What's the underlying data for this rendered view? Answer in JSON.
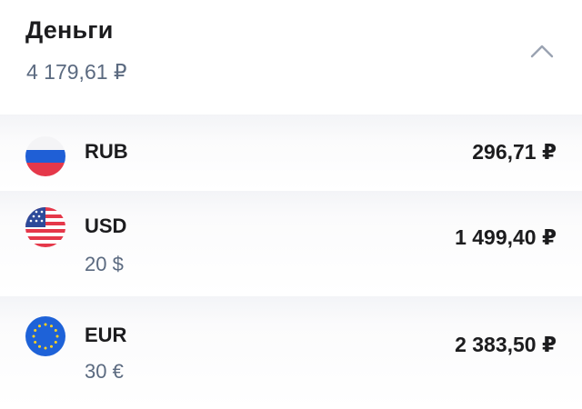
{
  "header": {
    "title": "Деньги",
    "total": "4 179,61 ₽",
    "collapse_icon": "chevron-up-icon"
  },
  "colors": {
    "text_primary": "#1c1c1e",
    "text_secondary": "#5b6a80",
    "chevron": "#9aa3b2",
    "eur_blue": "#1e62d8"
  },
  "currencies": [
    {
      "code": "RUB",
      "amount": "296,71 ₽",
      "flag": "russia-flag-icon"
    },
    {
      "code": "USD",
      "amount": "1 499,40 ₽",
      "native": "20 $",
      "flag": "usa-flag-icon"
    },
    {
      "code": "EUR",
      "amount": "2 383,50 ₽",
      "native": "30 €",
      "flag": "eu-flag-icon"
    }
  ]
}
